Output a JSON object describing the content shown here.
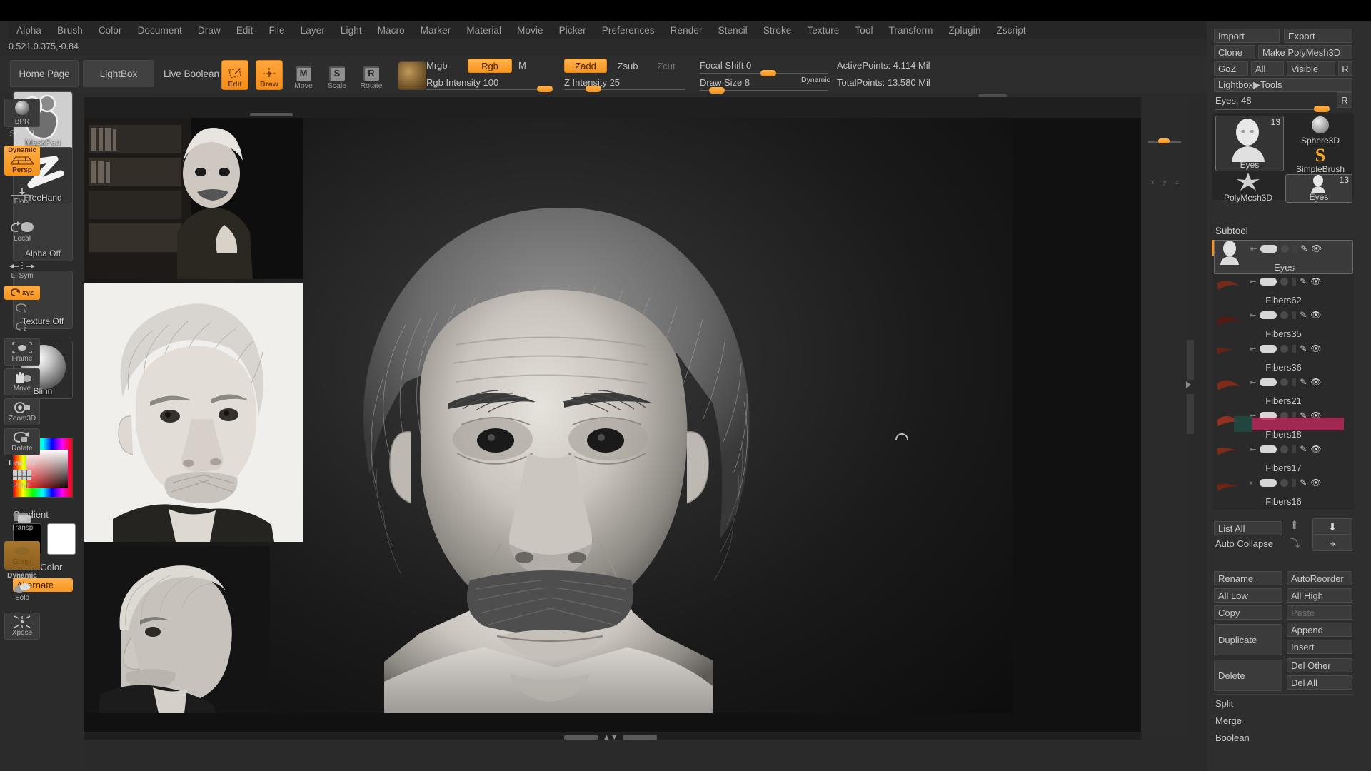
{
  "menu": {
    "items": [
      "Alpha",
      "Brush",
      "Color",
      "Document",
      "Draw",
      "Edit",
      "File",
      "Layer",
      "Light",
      "Macro",
      "Marker",
      "Material",
      "Movie",
      "Picker",
      "Preferences",
      "Render",
      "Stencil",
      "Stroke",
      "Texture",
      "Tool",
      "Transform",
      "Zplugin",
      "Zscript"
    ]
  },
  "coords": "0.521.0.375,-0.84",
  "toolbar": {
    "home_page": "Home Page",
    "lightbox": "LightBox",
    "live_boolean": "Live Boolean",
    "edit": "Edit",
    "draw": "Draw",
    "move": "Move",
    "scale": "Scale",
    "rotate": "Rotate",
    "move_glyph": "M",
    "scale_glyph": "S",
    "rotate_glyph": "R",
    "mrgb": "Mrgb",
    "rgb": "Rgb",
    "m": "M",
    "rgb_intensity": "Rgb Intensity 100",
    "zadd": "Zadd",
    "zsub": "Zsub",
    "zcut": "Zcut",
    "z_intensity": "Z Intensity 25",
    "focal_shift": "Focal Shift 0",
    "draw_size": "Draw Size 8",
    "dynamic": "Dynamic",
    "active_points": "ActivePoints: 4.114 Mil",
    "total_points": "TotalPoints: 13.580 Mil"
  },
  "left_palette": {
    "brush": "MaskPen",
    "stroke": "FreeHand",
    "alpha": "Alpha Off",
    "texture": "Texture Off",
    "material": "Blinn",
    "gradient": "Gradient",
    "switch_color": "SwitchColor",
    "alternate": "Alternate"
  },
  "right_toolbar": {
    "bpr": "BPR",
    "spix": "SPix  3",
    "persp": "Persp",
    "persp_tag": "Dynamic",
    "floor": "Floor",
    "local": "Local",
    "lsym": "L. Sym",
    "xyz": "xyz",
    "frame": "Frame",
    "move": "Move",
    "zoom3d": "Zoom3D",
    "rotate": "Rotate",
    "line_fill": "Line Fill",
    "polyf": "PolyF",
    "transp": "Transp",
    "ghost": "Ghost",
    "dynamic": "Dynamic",
    "solo": "Solo",
    "xpose": "Xpose"
  },
  "right_panel": {
    "import": "Import",
    "export": "Export",
    "clone": "Clone",
    "make_polymesh3d": "Make PolyMesh3D",
    "goz": "GoZ",
    "all": "All",
    "visible": "Visible",
    "r1": "R",
    "lightbox_tools": "Lightbox▶Tools",
    "eyes_slider": "Eyes. 48",
    "r2": "R",
    "tool_tiles": [
      {
        "name": "Eyes",
        "badge": "13",
        "selected": true
      },
      {
        "name": "Sphere3D",
        "badge": "",
        "selected": false
      },
      {
        "name": "SimpleBrush",
        "badge": "",
        "selected": false
      },
      {
        "name": "PolyMesh3D",
        "badge": "",
        "selected": false
      },
      {
        "name": "Eyes",
        "badge": "13",
        "selected": true
      }
    ],
    "subtool_title": "Subtool",
    "subtools": [
      {
        "name": "Eyes",
        "active": true
      },
      {
        "name": "Fibers62",
        "active": false
      },
      {
        "name": "Fibers35",
        "active": false
      },
      {
        "name": "Fibers36",
        "active": false
      },
      {
        "name": "Fibers21",
        "active": false
      },
      {
        "name": "Fibers18",
        "active": false
      },
      {
        "name": "Fibers17",
        "active": false
      },
      {
        "name": "Fibers16",
        "active": false
      }
    ],
    "list_all": "List All",
    "auto_collapse": "Auto Collapse",
    "rename": "Rename",
    "auto_reorder": "AutoReorder",
    "all_low": "All Low",
    "all_high": "All High",
    "copy": "Copy",
    "paste": "Paste",
    "duplicate": "Duplicate",
    "append": "Append",
    "insert": "Insert",
    "delete": "Delete",
    "del_other": "Del Other",
    "del_all": "Del All",
    "split": "Split",
    "merge": "Merge",
    "boolean": "Boolean"
  },
  "colors": {
    "accent": "#f79425",
    "panel_bg": "#2e2e2e",
    "canvas_bg": "#1a1a1a",
    "text": "#c8c8c8"
  }
}
